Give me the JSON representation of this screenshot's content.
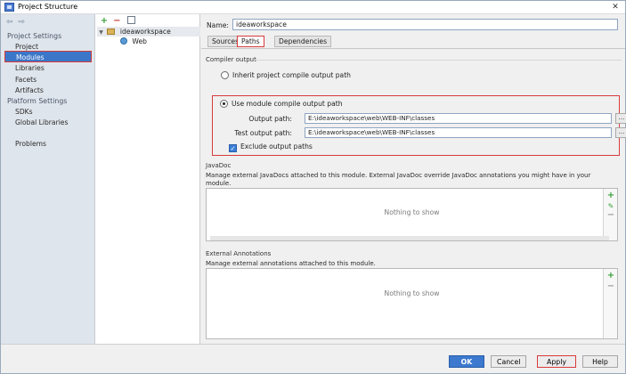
{
  "window": {
    "title": "Project Structure",
    "close_glyph": "✕"
  },
  "nav": {
    "back_glyph": "⇦",
    "forward_glyph": "⇨",
    "project_settings_header": "Project Settings",
    "project_settings_items": [
      "Project",
      "Modules",
      "Libraries",
      "Facets",
      "Artifacts"
    ],
    "platform_settings_header": "Platform Settings",
    "platform_settings_items": [
      "SDKs",
      "Global Libraries"
    ],
    "other_items": [
      "Problems"
    ],
    "selected": "Modules"
  },
  "tree": {
    "toolbar": {
      "add_glyph": "+",
      "remove_glyph": "−"
    },
    "module": "ideaworkspace",
    "facet": "Web"
  },
  "module": {
    "name_label": "Name:",
    "name_value": "ideaworkspace",
    "tabs": [
      "Sources",
      "Paths",
      "Dependencies"
    ],
    "active_tab": "Paths"
  },
  "compiler_output": {
    "title": "Compiler output",
    "inherit_label": "Inherit project compile output path",
    "use_module_label": "Use module compile output path",
    "selected_option": "use_module",
    "output_path_label": "Output path:",
    "output_path_value": "E:\\ideaworkspace\\web\\WEB-INF\\classes",
    "test_output_path_label": "Test output path:",
    "test_output_path_value": "E:\\ideaworkspace\\web\\WEB-INF\\classes",
    "browse_glyph": "...",
    "exclude_label": "Exclude output paths",
    "exclude_checked": true
  },
  "javadoc": {
    "title": "JavaDoc",
    "description": "Manage external JavaDocs attached to this module. External JavaDoc override JavaDoc annotations you might have in your module.",
    "empty_text": "Nothing to show",
    "add_glyph": "+",
    "add_url_glyph": "✎",
    "remove_glyph": "−"
  },
  "annotations": {
    "title": "External Annotations",
    "description": "Manage external annotations attached to this module.",
    "empty_text": "Nothing to show",
    "add_glyph": "+",
    "remove_glyph": "−"
  },
  "buttons": {
    "ok": "OK",
    "cancel": "Cancel",
    "apply": "Apply",
    "help": "Help"
  },
  "colors": {
    "selection": "#3b76c8",
    "highlight_outline": "#d83b3b",
    "primary_button": "#3c79cf"
  }
}
